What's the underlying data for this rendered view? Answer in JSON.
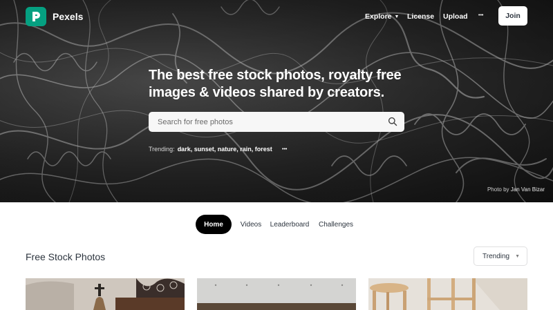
{
  "nav": {
    "logo_text": "Pexels",
    "explore": "Explore",
    "license": "License",
    "upload": "Upload",
    "more": "•••",
    "join": "Join"
  },
  "hero": {
    "headline": "The best free stock photos, royalty free images & videos shared by creators.",
    "search_placeholder": "Search for free photos",
    "trending_label": "Trending:",
    "trending_items": "dark, sunset, nature, rain, forest",
    "trending_more": "•••",
    "credit_prefix": "Photo by",
    "credit_name": "Jan Van Bizar"
  },
  "tabs": {
    "items": [
      "Home",
      "Videos",
      "Leaderboard",
      "Challenges"
    ]
  },
  "main": {
    "section_title": "Free Stock Photos",
    "sort_label": "Trending"
  },
  "colors": {
    "brand": "#05a081",
    "text": "#2c343e"
  },
  "icons": [
    "pexels-logo-icon",
    "chevron-down-icon",
    "more-icon",
    "search-icon"
  ]
}
